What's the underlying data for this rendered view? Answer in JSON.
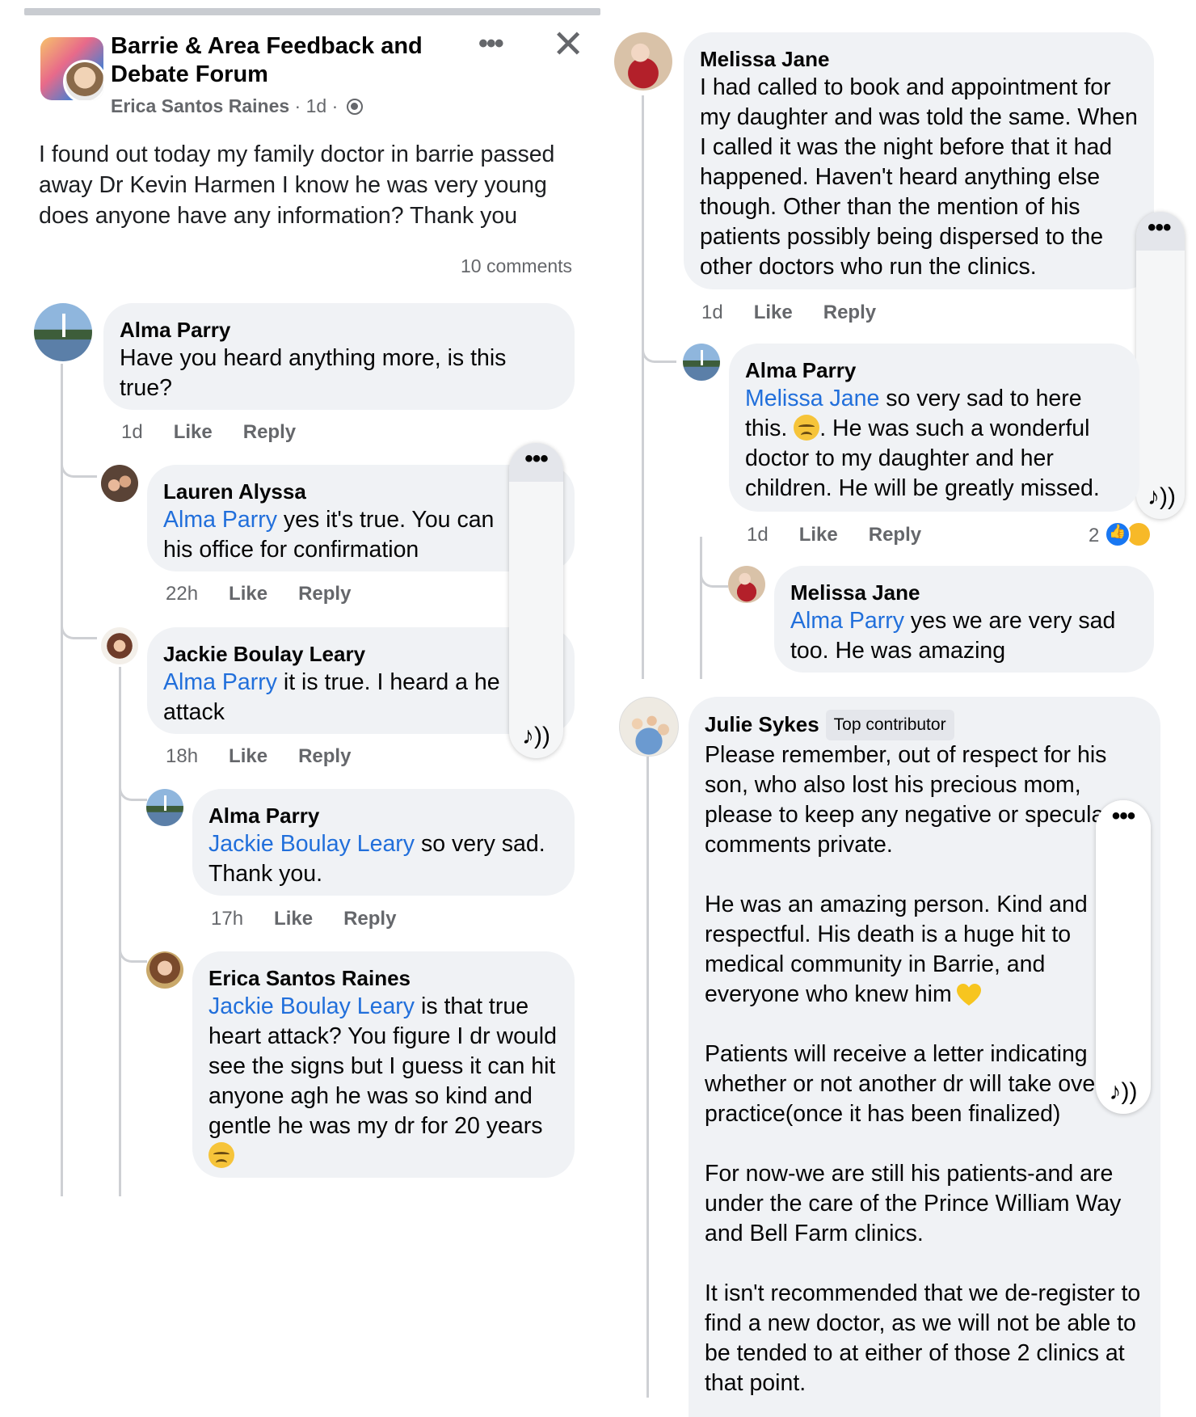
{
  "post": {
    "group_name": "Barrie & Area Feedback and Debate Forum",
    "author": "Erica Santos Raines",
    "time": "1d",
    "body": "I found out today my family doctor in barrie passed away Dr Kevin Harmen I know he was very young does anyone have any information? Thank you",
    "comment_count": "10 comments",
    "more_icon": "more-horizontal-icon",
    "close_icon": "close-icon",
    "privacy_icon": "globe-icon"
  },
  "labels": {
    "like": "Like",
    "reply": "Reply",
    "separator": "·",
    "dots": "•••",
    "audio": "♪))"
  },
  "left_comments": [
    {
      "name": "Alma Parry",
      "mention": "",
      "text": "Have you heard anything more, is this true?",
      "time": "1d"
    },
    {
      "name": "Lauren Alyssa",
      "mention": "Alma Parry",
      "text": " yes it's true. You can his office for confirmation",
      "time": "22h"
    },
    {
      "name": "Jackie Boulay Leary",
      "mention": "Alma Parry",
      "text": " it is true. I heard a he attack",
      "time": "18h"
    },
    {
      "name": "Alma Parry",
      "mention": "Jackie Boulay Leary",
      "text": " so very sad. Thank you.",
      "time": "17h"
    },
    {
      "name": "Erica Santos Raines",
      "mention": "Jackie Boulay Leary",
      "text": " is that true heart attack? You figure I dr would see the signs but I guess it can hit anyone agh he was so kind and gentle he was my dr for 20 years",
      "time": ""
    }
  ],
  "right_comments": [
    {
      "name": "Melissa Jane",
      "mention": "",
      "text": "I had called to book and appointment for my daughter and was told the same. When I called it was the night before that it had happened. Haven't heard anything else though. Other than the mention of his patients possibly being dispersed to the other doctors who run the clinics.",
      "time": "1d"
    },
    {
      "name": "Alma Parry",
      "mention": "Melissa Jane",
      "text_before_emoji": " so very sad to here this. ",
      "text_after_emoji": ". He was such a wonderful doctor to my daughter and her children. He will be greatly missed.",
      "time": "1d",
      "reaction_count": "2"
    },
    {
      "name": "Melissa Jane",
      "mention": "Alma Parry",
      "text": " yes we are very sad too. He was amazing",
      "time": ""
    },
    {
      "name": "Julie Sykes",
      "badge": "Top contributor",
      "paragraphs": [
        "Please remember, out of respect for his son, who also lost his precious mom, please to keep any negative or speculative comments private.",
        "He was an amazing person. Kind and respectful. His death  is a huge hit to medical community in Barrie, and everyone who knew him",
        "Patients will receive a letter indicating whether or not another dr will take over his practice(once it has been finalized)",
        "For now-we are still his patients-and are under the care of the Prince William Way and Bell Farm clinics.",
        "It isn't recommended that we de-register to find a new doctor, as we will not be able to be tended to at either of those 2 clinics at that point."
      ]
    }
  ]
}
